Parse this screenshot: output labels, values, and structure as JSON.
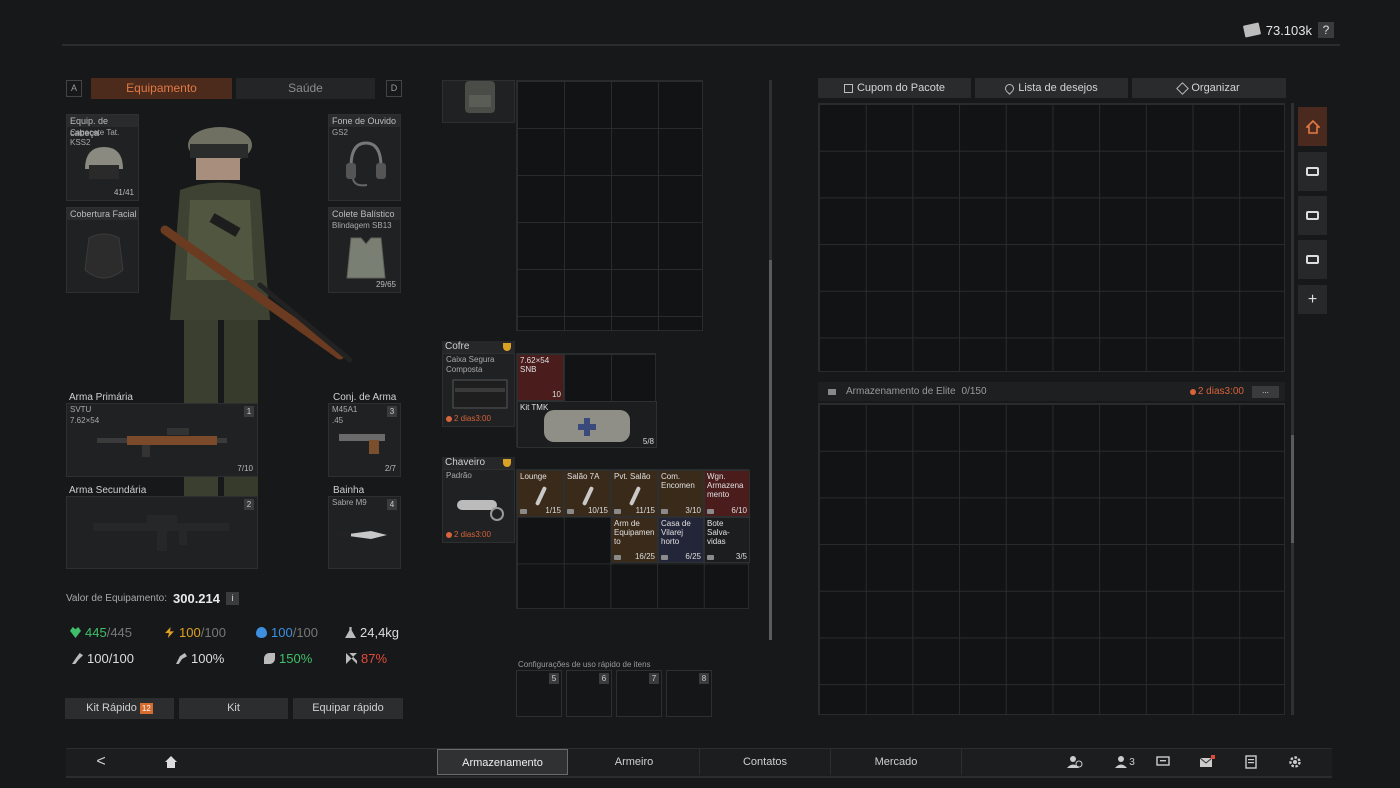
{
  "currency": {
    "amount": "73.103k",
    "help": "?"
  },
  "equipment_tabs": {
    "key_left": "A",
    "key_right": "D",
    "equipment": "Equipamento",
    "health": "Saúde"
  },
  "slots": {
    "headgear": {
      "label": "Equip. de cabeça",
      "name": "Capacete Tat. KSS2",
      "count": "41/41"
    },
    "earpiece": {
      "label": "Fone de Ouvido",
      "name": "GS2"
    },
    "face_cover": {
      "label": "Cobertura Facial"
    },
    "body_armor": {
      "label": "Colete Balístico",
      "name": "Blindagem SB13",
      "count": "29/65"
    },
    "primary": {
      "label": "Arma Primária",
      "name": "SVTU",
      "sub": "7.62×54",
      "count": "7/10",
      "num": "1"
    },
    "weapon_set": {
      "label": "Conj. de Arma",
      "name": "M45A1",
      "sub": ".45",
      "count": "2/7",
      "num": "3"
    },
    "secondary": {
      "label": "Arma Secundária",
      "num": "2"
    },
    "sheath": {
      "label": "Bainha",
      "name": "Sabre M9",
      "num": "4"
    }
  },
  "equipment_value": {
    "label": "Valor de Equipamento:",
    "value": "300.214",
    "info": "i"
  },
  "stats": {
    "health_current": "445",
    "health_max": "/445",
    "energy_current": "100",
    "energy_max": "/100",
    "hydration_current": "100",
    "hydration_max": "/100",
    "weight": "24,4kg",
    "stamina": "100/100",
    "speed": "100%",
    "bonus": "150%",
    "penalty": "87%"
  },
  "action_buttons": {
    "quick_kit": "Kit Rápido",
    "quick_kit_badge": "12",
    "kit": "Kit",
    "quick_equip": "Equipar rápido"
  },
  "safe": {
    "header": "Cofre",
    "name": "Caixa Segura Composta",
    "timer": "2 dias3:00",
    "ammo_name": "7.62×54 SNB",
    "ammo_count": "10",
    "medkit_name": "Kit TMK",
    "medkit_count": "5/8"
  },
  "keychain": {
    "header": "Chaveiro",
    "name": "Padrão",
    "timer": "2 dias3:00",
    "keys": [
      {
        "name": "Lounge",
        "count": "1/15"
      },
      {
        "name": "Salão 7A",
        "count": "10/15"
      },
      {
        "name": "Pvt. Salão",
        "count": "11/15"
      },
      {
        "name": "Com. Encomen",
        "count": "3/10"
      },
      {
        "name": "Wgn. Armazena mento",
        "count": "6/10"
      },
      {
        "name": "Arm de Equipamen to",
        "count": "16/25"
      },
      {
        "name": "Casa de Vilarej horto",
        "count": "6/25"
      },
      {
        "name": "Bote Salva-vidas",
        "count": "3/5"
      }
    ]
  },
  "quick_use": {
    "label": "Configurações de uso rápido de itens",
    "slots": [
      "5",
      "6",
      "7",
      "8"
    ]
  },
  "storage_buttons": {
    "package_coupon": "Cupom do Pacote",
    "wishlist": "Lista de desejos",
    "organize": "Organizar"
  },
  "elite_storage": {
    "title": "Armazenamento de Elite",
    "capacity": "0/150",
    "timer": "2 dias3:00",
    "more": "..."
  },
  "side_plus": "+",
  "bottom_nav": {
    "back": "<",
    "storage": "Armazenamento",
    "gunsmith": "Armeiro",
    "contacts": "Contatos",
    "market": "Mercado",
    "friends_count": "3"
  },
  "colors": {
    "accent": "#e27a45",
    "health": "#3fbf6a",
    "energy": "#e0a020",
    "hydration": "#3d8fe0",
    "penalty": "#e04a3a"
  }
}
